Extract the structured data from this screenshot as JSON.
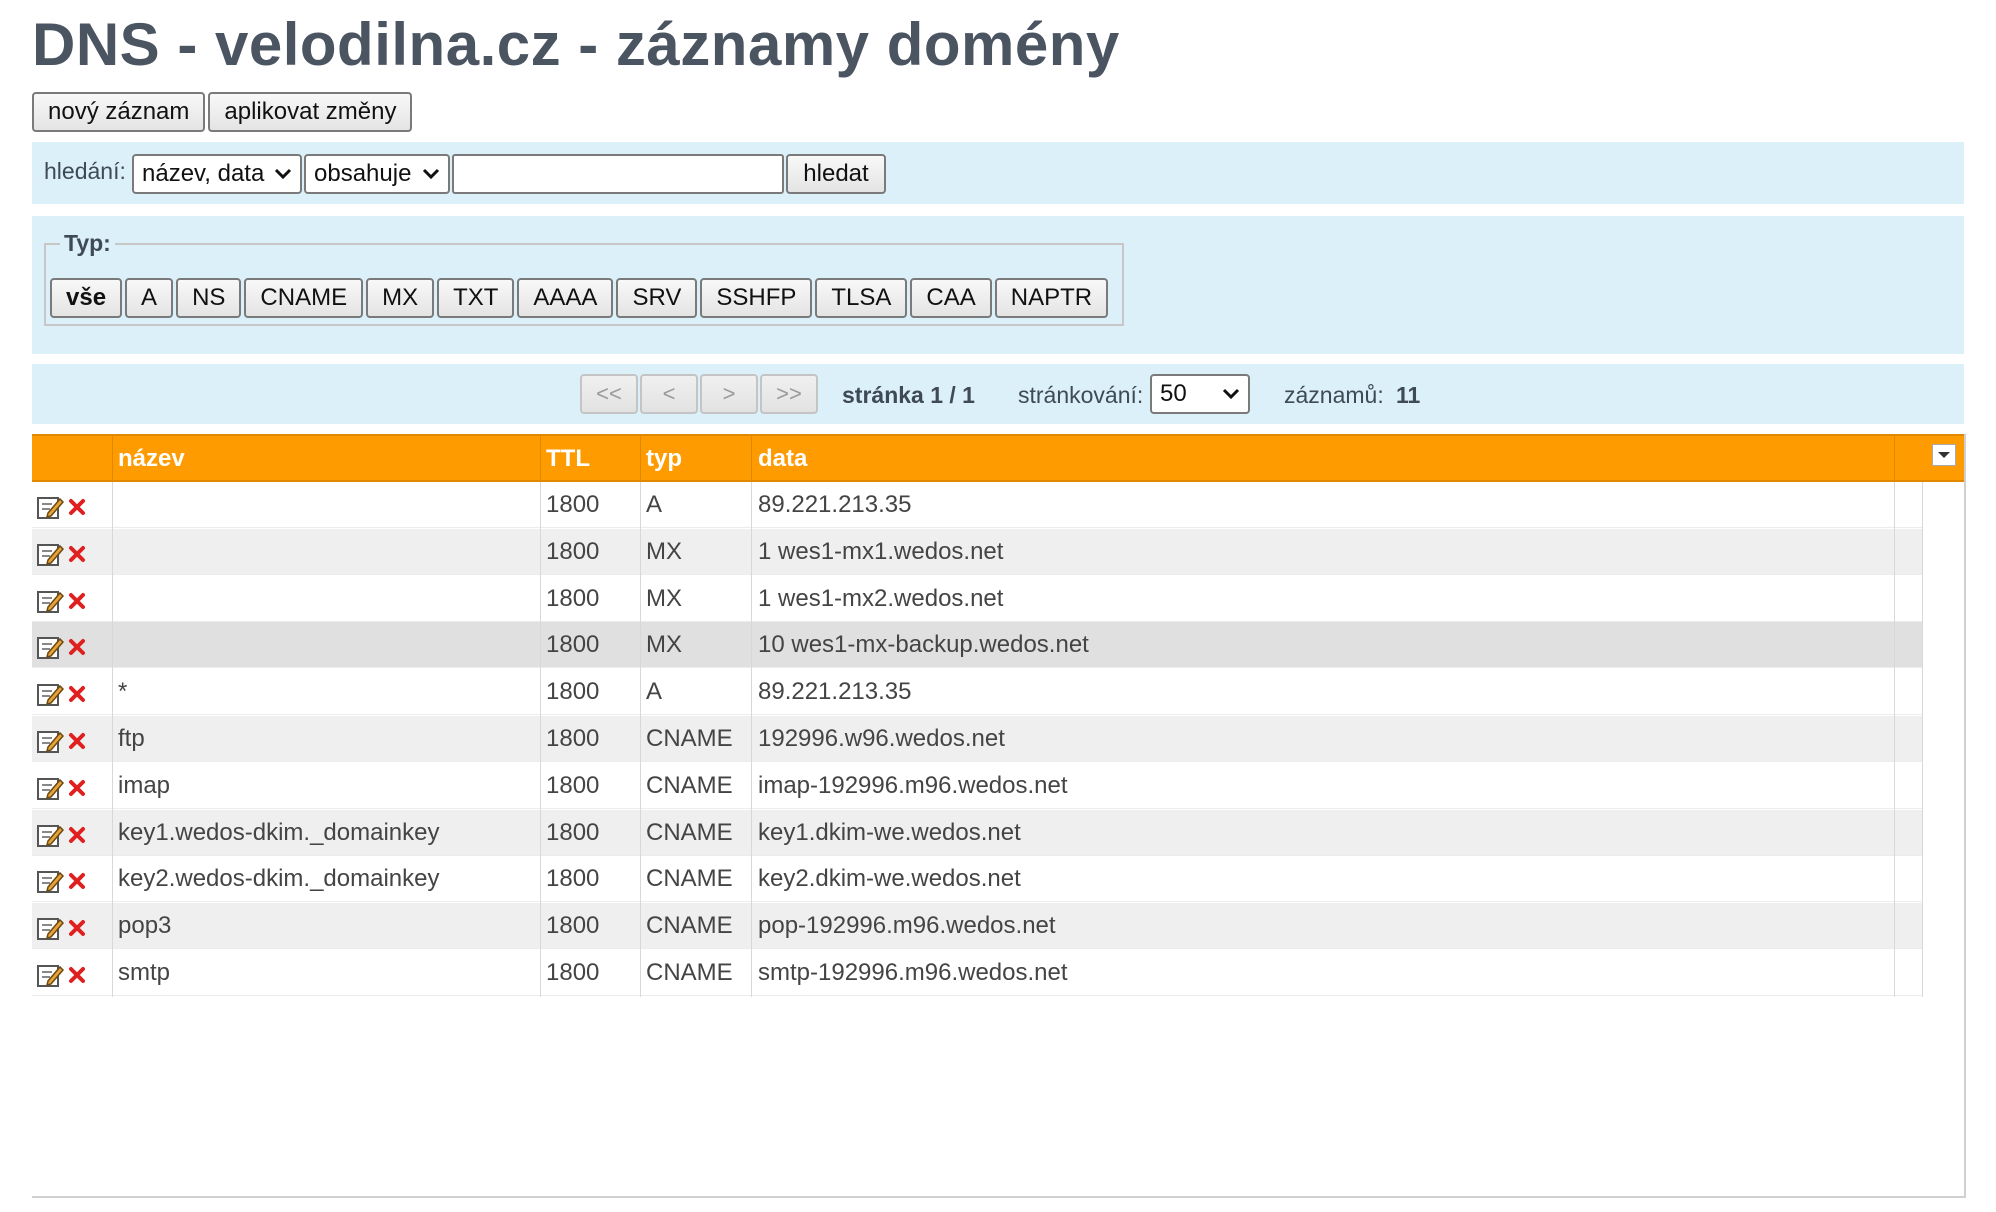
{
  "page": {
    "title": "DNS - velodilna.cz - záznamy domény"
  },
  "actions": {
    "new_record": "nový záznam",
    "apply_changes": "aplikovat změny"
  },
  "search": {
    "label": "hledání:",
    "field_select": "název, data",
    "mode_select": "obsahuje",
    "query": "",
    "button": "hledat"
  },
  "type_filter": {
    "legend": "Typ:",
    "buttons": [
      "vše",
      "A",
      "NS",
      "CNAME",
      "MX",
      "TXT",
      "AAAA",
      "SRV",
      "SSHFP",
      "TLSA",
      "CAA",
      "NAPTR"
    ],
    "active": "vše"
  },
  "pager": {
    "first": "<<",
    "prev": "<",
    "next": ">",
    "last": ">>",
    "page_label": "stránka 1 / 1",
    "per_page_label": "stránkování:",
    "per_page": "50",
    "count_label": "záznamů:",
    "count": "11"
  },
  "table": {
    "headers": {
      "name": "název",
      "ttl": "TTL",
      "type": "typ",
      "data": "data"
    },
    "rows": [
      {
        "name": "",
        "ttl": "1800",
        "type": "A",
        "data": "89.221.213.35"
      },
      {
        "name": "",
        "ttl": "1800",
        "type": "MX",
        "data": "1 wes1-mx1.wedos.net"
      },
      {
        "name": "",
        "ttl": "1800",
        "type": "MX",
        "data": "1 wes1-mx2.wedos.net"
      },
      {
        "name": "",
        "ttl": "1800",
        "type": "MX",
        "data": "10 wes1-mx-backup.wedos.net"
      },
      {
        "name": "*",
        "ttl": "1800",
        "type": "A",
        "data": "89.221.213.35"
      },
      {
        "name": "ftp",
        "ttl": "1800",
        "type": "CNAME",
        "data": "192996.w96.wedos.net"
      },
      {
        "name": "imap",
        "ttl": "1800",
        "type": "CNAME",
        "data": "imap-192996.m96.wedos.net"
      },
      {
        "name": "key1.wedos-dkim._domainkey",
        "ttl": "1800",
        "type": "CNAME",
        "data": "key1.dkim-we.wedos.net"
      },
      {
        "name": "key2.wedos-dkim._domainkey",
        "ttl": "1800",
        "type": "CNAME",
        "data": "key2.dkim-we.wedos.net"
      },
      {
        "name": "pop3",
        "ttl": "1800",
        "type": "CNAME",
        "data": "pop-192996.m96.wedos.net"
      },
      {
        "name": "smtp",
        "ttl": "1800",
        "type": "CNAME",
        "data": "smtp-192996.m96.wedos.net"
      }
    ]
  },
  "colors": {
    "header_bg": "#fd9b00",
    "panel_bg": "#dbf0f9",
    "title": "#4b5461",
    "delete_icon": "#e02020"
  }
}
